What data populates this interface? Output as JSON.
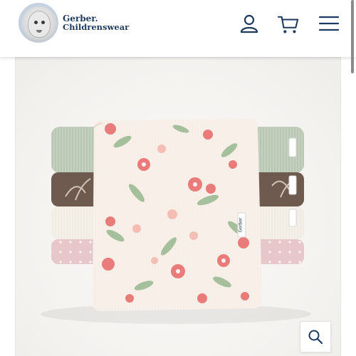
{
  "header": {
    "logo": {
      "line1": "Gerber.",
      "line2": "Childrenswear",
      "icon": "gerber-baby-logo-icon"
    },
    "icons": {
      "account": "user-icon",
      "cart": "cart-icon",
      "menu": "hamburger-menu-icon"
    },
    "accent_color": "#1f3a5f"
  },
  "product": {
    "image_label": "Gerber",
    "zoom_icon": "search-zoom-icon",
    "colors": {
      "sage": "#b9c7b2",
      "brown": "#6e5a4f",
      "cream": "#f1ece3",
      "pink": "#e7c7c9",
      "floral_bg": "#f6eee6",
      "flower": "#e97c7b",
      "leaf": "#9dbb95"
    }
  }
}
